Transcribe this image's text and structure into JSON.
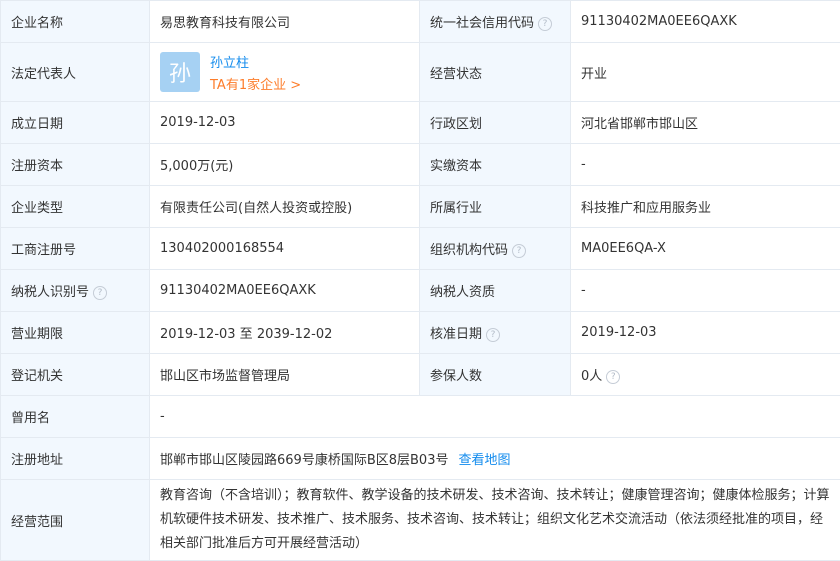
{
  "company": {
    "name_label": "企业名称",
    "name": "易思教育科技有限公司",
    "credit_code_label": "统一社会信用代码",
    "credit_code": "91130402MA0EE6QAXK",
    "legal_rep_label": "法定代表人",
    "legal_rep_avatar": "孙",
    "legal_rep": "孙立柱",
    "legal_rep_link": "TA有1家企业 >",
    "status_label": "经营状态",
    "status": "开业",
    "established_label": "成立日期",
    "established": "2019-12-03",
    "region_label": "行政区划",
    "region": "河北省邯郸市邯山区",
    "reg_capital_label": "注册资本",
    "reg_capital": "5,000万(元)",
    "paid_capital_label": "实缴资本",
    "paid_capital": "-",
    "type_label": "企业类型",
    "type": "有限责任公司(自然人投资或控股)",
    "industry_label": "所属行业",
    "industry": "科技推广和应用服务业",
    "reg_no_label": "工商注册号",
    "reg_no": "130402000168554",
    "org_code_label": "组织机构代码",
    "org_code": "MA0EE6QA-X",
    "taxpayer_id_label": "纳税人识别号",
    "taxpayer_id": "91130402MA0EE6QAXK",
    "taxpayer_qual_label": "纳税人资质",
    "taxpayer_qual": "-",
    "term_label": "营业期限",
    "term": "2019-12-03 至 2039-12-02",
    "approval_date_label": "核准日期",
    "approval_date": "2019-12-03",
    "authority_label": "登记机关",
    "authority": "邯山区市场监督管理局",
    "insured_label": "参保人数",
    "insured": "0人",
    "former_name_label": "曾用名",
    "former_name": "-",
    "address_label": "注册地址",
    "address": "邯郸市邯山区陵园路669号康桥国际B区8层B03号",
    "map_link": "查看地图",
    "scope_label": "经营范围",
    "scope": "教育咨询（不含培训）；教育软件、教学设备的技术研发、技术咨询、技术转让；健康管理咨询；健康体检服务；计算机软硬件技术研发、技术推广、技术服务、技术咨询、技术转让；组织文化艺术交流活动（依法须经批准的项目，经相关部门批准后方可开展经营活动）"
  },
  "icons": {
    "help": "question-circle-icon"
  },
  "colors": {
    "label_bg": "#f2f8fe",
    "border": "#e4eaf1",
    "link": "#128bed",
    "orange_link": "#fd7d2b",
    "avatar_bg": "#a6d1f3"
  }
}
